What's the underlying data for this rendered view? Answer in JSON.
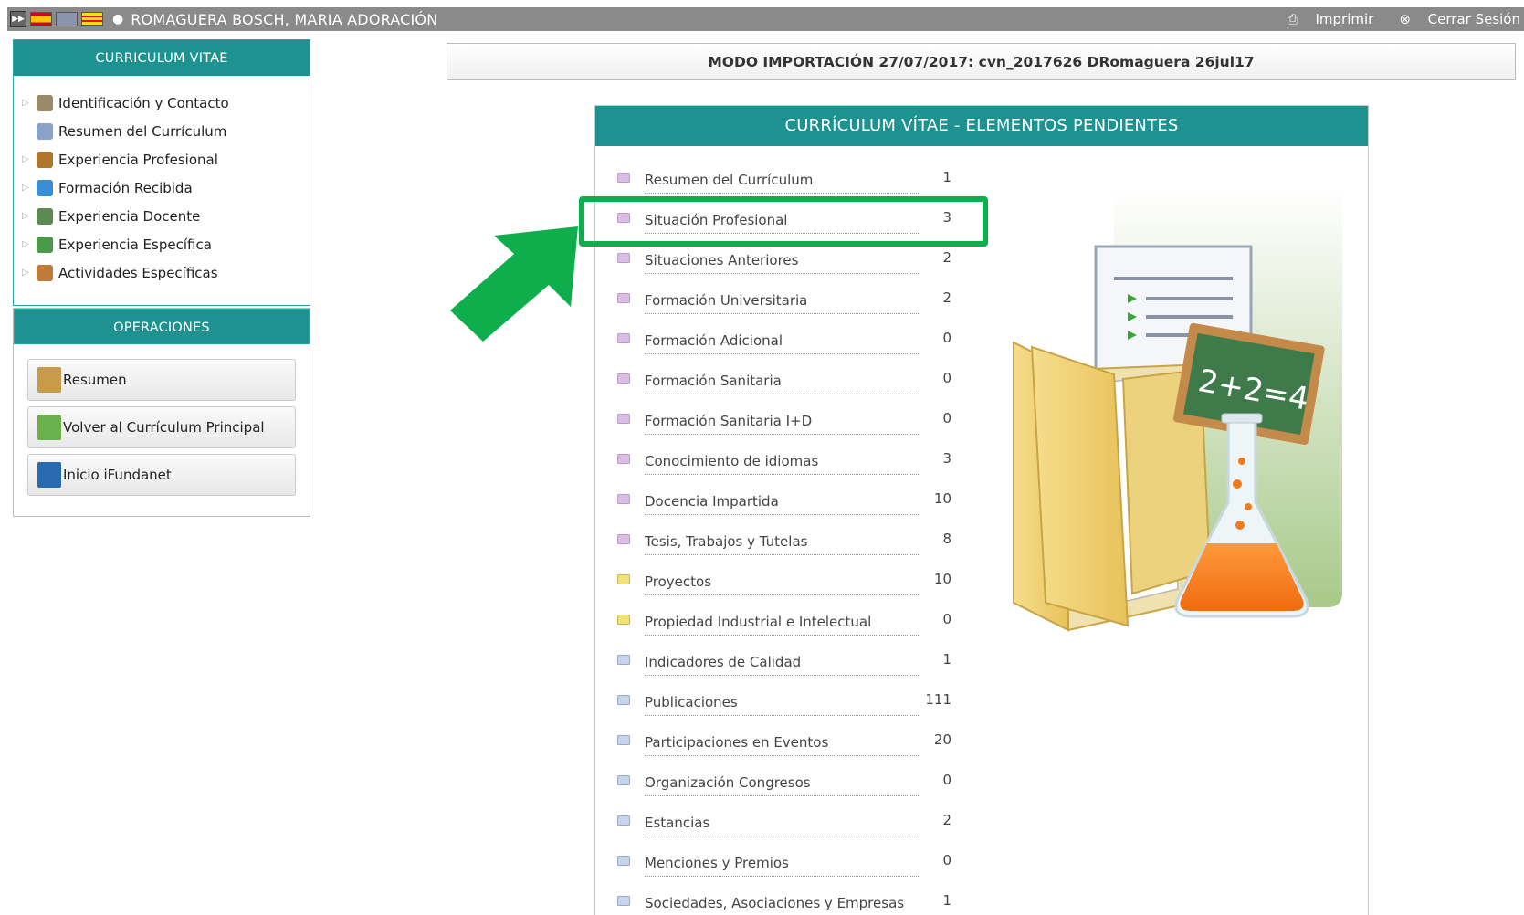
{
  "topbar": {
    "user_name": "ROMAGUERA BOSCH, MARIA ADORACIÓN",
    "print_label": "Imprimir",
    "logout_label": "Cerrar Sesión"
  },
  "sidebar": {
    "cv_title": "CURRICULUM VITAE",
    "items": [
      {
        "label": "Identificación y Contacto",
        "expandable": true,
        "icon": "contact-card-icon",
        "color": "#9a8a6a"
      },
      {
        "label": "Resumen del Currículum",
        "expandable": false,
        "icon": "document-icon",
        "color": "#8aa2c8"
      },
      {
        "label": "Experiencia Profesional",
        "expandable": true,
        "icon": "briefcase-icon",
        "color": "#b0742a"
      },
      {
        "label": "Formación Recibida",
        "expandable": true,
        "icon": "drop-icon",
        "color": "#3a8fd4"
      },
      {
        "label": "Experiencia Docente",
        "expandable": true,
        "icon": "chalkboard-icon",
        "color": "#5d8a52"
      },
      {
        "label": "Experiencia Específica",
        "expandable": true,
        "icon": "molecule-icon",
        "color": "#4a9a4a"
      },
      {
        "label": "Actividades Específicas",
        "expandable": true,
        "icon": "pills-icon",
        "color": "#c07a3a"
      }
    ],
    "ops_title": "OPERACIONES",
    "ops": [
      {
        "label": "Resumen",
        "icon": "clipboard-icon",
        "color": "#c89a4a"
      },
      {
        "label": "Volver al Currículum Principal",
        "icon": "return-icon",
        "color": "#6ab04c"
      },
      {
        "label": "Inicio iFundanet",
        "icon": "ifundanet-logo-icon",
        "color": "#2a6ab0"
      }
    ]
  },
  "banner": {
    "text": "MODO IMPORTACIÓN 27/07/2017: cvn_2017626 DRomaguera 26jul17"
  },
  "main": {
    "title": "CURRÍCULUM VÍTAE - ELEMENTOS PENDIENTES",
    "rows": [
      {
        "label": "Resumen del Currículum",
        "count": "1",
        "color": "pink"
      },
      {
        "label": "Situación Profesional",
        "count": "3",
        "color": "pink"
      },
      {
        "label": "Situaciones Anteriores",
        "count": "2",
        "color": "pink"
      },
      {
        "label": "Formación Universitaria",
        "count": "2",
        "color": "pink"
      },
      {
        "label": "Formación Adicional",
        "count": "0",
        "color": "pink"
      },
      {
        "label": "Formación Sanitaria",
        "count": "0",
        "color": "pink"
      },
      {
        "label": "Formación Sanitaria I+D",
        "count": "0",
        "color": "pink"
      },
      {
        "label": "Conocimiento de idiomas",
        "count": "3",
        "color": "pink"
      },
      {
        "label": "Docencia Impartida",
        "count": "10",
        "color": "pink"
      },
      {
        "label": "Tesis, Trabajos y Tutelas",
        "count": "8",
        "color": "pink"
      },
      {
        "label": "Proyectos",
        "count": "10",
        "color": "yellow"
      },
      {
        "label": "Propiedad Industrial e Intelectual",
        "count": "0",
        "color": "yellow"
      },
      {
        "label": "Indicadores de Calidad",
        "count": "1",
        "color": "blue"
      },
      {
        "label": "Publicaciones",
        "count": "111",
        "color": "blue"
      },
      {
        "label": "Participaciones en Eventos",
        "count": "20",
        "color": "blue"
      },
      {
        "label": "Organización Congresos",
        "count": "0",
        "color": "blue"
      },
      {
        "label": "Estancias",
        "count": "2",
        "color": "blue"
      },
      {
        "label": "Menciones y Premios",
        "count": "0",
        "color": "blue"
      },
      {
        "label": "Sociedades, Asociaciones y Empresas",
        "count": "1",
        "color": "blue"
      }
    ],
    "chalkboard_text": "2+2=4"
  },
  "annotation": {
    "highlight_color": "#0fae4c"
  }
}
